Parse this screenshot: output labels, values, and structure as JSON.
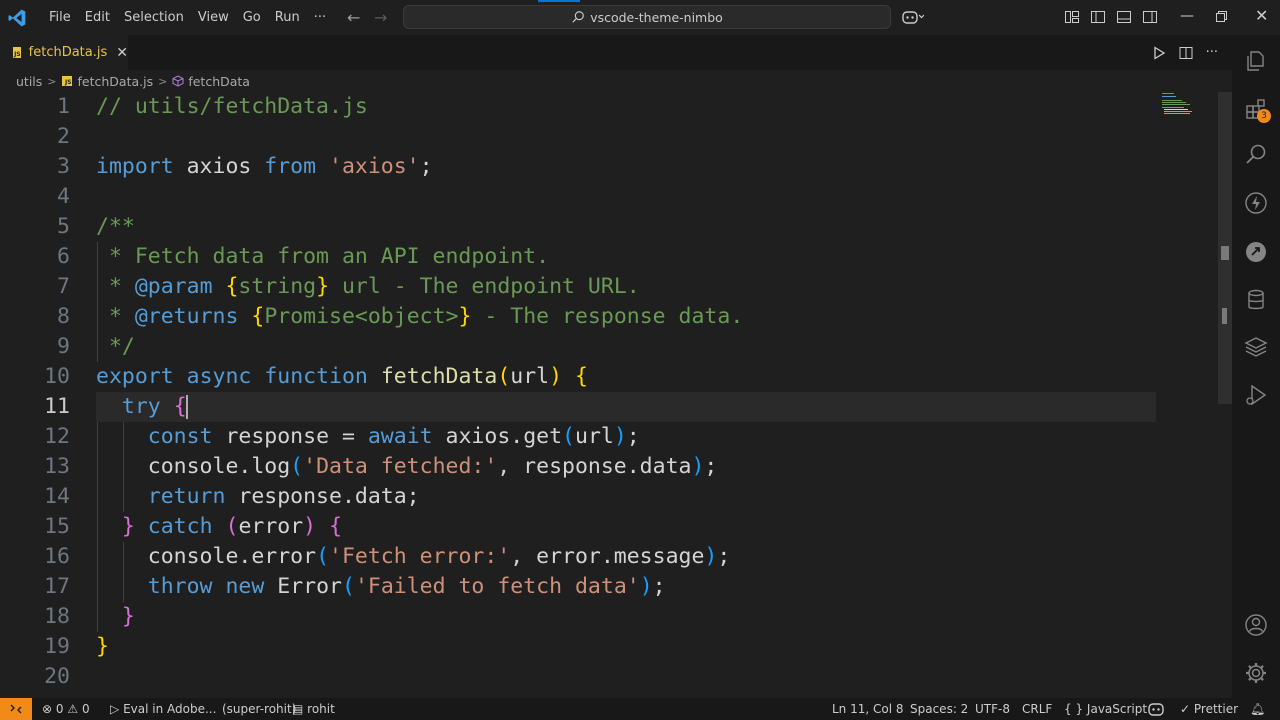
{
  "menu": [
    "File",
    "Edit",
    "Selection",
    "View",
    "Go",
    "Run",
    "···"
  ],
  "search": {
    "label": "vscode-theme-nimbo"
  },
  "tab": {
    "label": "fetchData.js",
    "icon": "js-file-icon",
    "badge": "JS"
  },
  "breadcrumb": [
    "utils",
    "fetchData.js",
    "fetchData"
  ],
  "editor": {
    "cursor_line": 11,
    "lines": [
      [
        [
          "c-cm",
          "// utils/fetchData.js"
        ]
      ],
      [],
      [
        [
          "c-kw",
          "import"
        ],
        [
          "c-id",
          " axios "
        ],
        [
          "c-kw",
          "from"
        ],
        [
          "c-id",
          " "
        ],
        [
          "c-str",
          "'axios'"
        ],
        [
          "c-id",
          ";"
        ]
      ],
      [],
      [
        [
          "c-cm",
          "/**"
        ]
      ],
      [
        [
          "c-cm",
          " * Fetch data from an API endpoint."
        ]
      ],
      [
        [
          "c-cm",
          " * "
        ],
        [
          "c-doc",
          "@param"
        ],
        [
          "c-cm",
          " "
        ],
        [
          "b1",
          "{"
        ],
        [
          "c-cm",
          "string"
        ],
        [
          "b1",
          "}"
        ],
        [
          "c-cm",
          " url - The endpoint URL."
        ]
      ],
      [
        [
          "c-cm",
          " * "
        ],
        [
          "c-doc",
          "@returns"
        ],
        [
          "c-cm",
          " "
        ],
        [
          "b1",
          "{"
        ],
        [
          "c-cm",
          "Promise<object>"
        ],
        [
          "b1",
          "}"
        ],
        [
          "c-cm",
          " - The response data."
        ]
      ],
      [
        [
          "c-cm",
          " */"
        ]
      ],
      [
        [
          "c-kw",
          "export"
        ],
        [
          "c-id",
          " "
        ],
        [
          "c-kw",
          "async"
        ],
        [
          "c-id",
          " "
        ],
        [
          "c-kw",
          "function"
        ],
        [
          "c-id",
          " "
        ],
        [
          "c-fn",
          "fetchData"
        ],
        [
          "b1",
          "("
        ],
        [
          "c-id",
          "url"
        ],
        [
          "b1",
          ")"
        ],
        [
          "c-id",
          " "
        ],
        [
          "b1",
          "{"
        ]
      ],
      [
        [
          "c-id",
          "  "
        ],
        [
          "c-kw",
          "try"
        ],
        [
          "c-id",
          " "
        ],
        [
          "b2",
          "{"
        ]
      ],
      [
        [
          "c-id",
          "    "
        ],
        [
          "c-kw",
          "const"
        ],
        [
          "c-id",
          " response = "
        ],
        [
          "c-kw",
          "await"
        ],
        [
          "c-id",
          " axios.get"
        ],
        [
          "b3",
          "("
        ],
        [
          "c-id",
          "url"
        ],
        [
          "b3",
          ")"
        ],
        [
          "c-id",
          ";"
        ]
      ],
      [
        [
          "c-id",
          "    console.log"
        ],
        [
          "b3",
          "("
        ],
        [
          "c-str",
          "'Data fetched:'"
        ],
        [
          "c-id",
          ", response.data"
        ],
        [
          "b3",
          ")"
        ],
        [
          "c-id",
          ";"
        ]
      ],
      [
        [
          "c-id",
          "    "
        ],
        [
          "c-kw",
          "return"
        ],
        [
          "c-id",
          " response.data;"
        ]
      ],
      [
        [
          "c-id",
          "  "
        ],
        [
          "b2",
          "}"
        ],
        [
          "c-id",
          " "
        ],
        [
          "c-kw",
          "catch"
        ],
        [
          "c-id",
          " "
        ],
        [
          "b2",
          "("
        ],
        [
          "c-id",
          "error"
        ],
        [
          "b2",
          ")"
        ],
        [
          "c-id",
          " "
        ],
        [
          "b2",
          "{"
        ]
      ],
      [
        [
          "c-id",
          "    console.error"
        ],
        [
          "b3",
          "("
        ],
        [
          "c-str",
          "'Fetch error:'"
        ],
        [
          "c-id",
          ", error.message"
        ],
        [
          "b3",
          ")"
        ],
        [
          "c-id",
          ";"
        ]
      ],
      [
        [
          "c-id",
          "    "
        ],
        [
          "c-kw",
          "throw"
        ],
        [
          "c-id",
          " "
        ],
        [
          "c-kw",
          "new"
        ],
        [
          "c-id",
          " Error"
        ],
        [
          "b3",
          "("
        ],
        [
          "c-str",
          "'Failed to fetch data'"
        ],
        [
          "b3",
          ")"
        ],
        [
          "c-id",
          ";"
        ]
      ],
      [
        [
          "c-id",
          "  "
        ],
        [
          "b2",
          "}"
        ]
      ],
      [
        [
          "b1",
          "}"
        ]
      ],
      []
    ]
  },
  "activity": {
    "extensions_badge": "3"
  },
  "status": {
    "errors": "0",
    "warnings": "0",
    "eval": "Eval in Adobe...",
    "profile": "(super-rohit)",
    "user": "rohit",
    "position": "Ln 11, Col 8",
    "spaces": "Spaces: 2",
    "encoding": "UTF-8",
    "eol": "CRLF",
    "language": "JavaScript",
    "formatter": "Prettier"
  },
  "colors": {
    "accent": "#0078d4",
    "remote": "#f28a1a",
    "keyword": "#569cd6",
    "string": "#ce9178",
    "comment": "#6a9955",
    "function": "#dcdcaa"
  }
}
